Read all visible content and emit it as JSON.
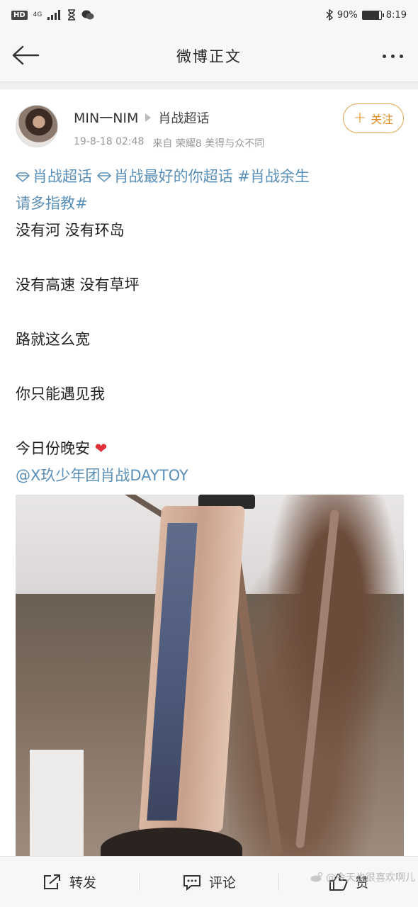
{
  "status_bar": {
    "hd": "HD",
    "network": "4G",
    "battery_text": "90%",
    "battery_level": 0.9,
    "time": "8:19"
  },
  "nav": {
    "title": "微博正文"
  },
  "post": {
    "username": "MIN一NIM",
    "supertopic": "肖战超话",
    "timestamp": "19-8-18 02:48",
    "source": "来自 荣耀8 美得与众不同",
    "follow_label": "关注",
    "topic_line_1": "肖战超话",
    "topic_line_1b": "肖战最好的你超话 #肖战余生",
    "topic_line_2": "请多指教#",
    "lines": [
      "没有河 没有环岛",
      "没有高速 没有草坪",
      "路就这么宽",
      "你只能遇见我",
      "今日份晚安"
    ],
    "mention": "@X玖少年团肖战DAYTOY"
  },
  "actions": {
    "repost": "转发",
    "comment": "评论",
    "like": "赞"
  },
  "watermark": "@今天也很喜欢啊儿"
}
